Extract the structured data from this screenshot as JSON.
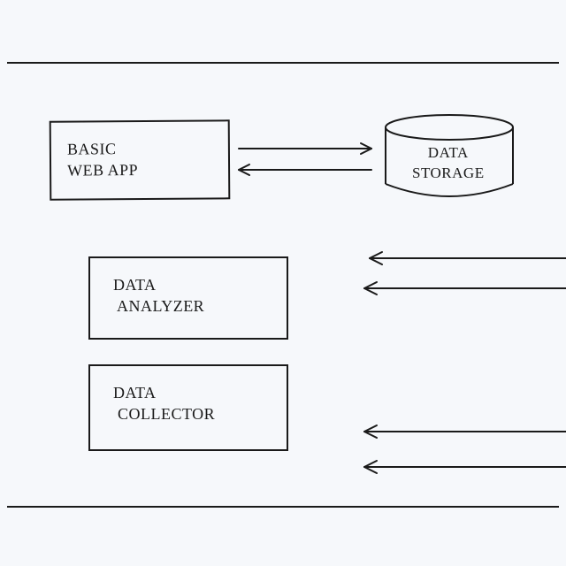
{
  "diagram": {
    "nodes": {
      "webapp": {
        "label": "Basic\nWeb App"
      },
      "storage": {
        "label": "Data\nStorage"
      },
      "analyzer": {
        "label": "Data\n Analyzer"
      },
      "collector": {
        "label": "Data\n Collector"
      }
    },
    "edges": [
      {
        "from": "webapp",
        "to": "storage",
        "direction": "bidirectional"
      },
      {
        "from": "external-right",
        "to": "analyzer",
        "direction": "in"
      },
      {
        "from": "external-right",
        "to": "analyzer",
        "direction": "in"
      },
      {
        "from": "external-right",
        "to": "collector",
        "direction": "in"
      },
      {
        "from": "external-right",
        "to": "collector",
        "direction": "in"
      }
    ]
  }
}
